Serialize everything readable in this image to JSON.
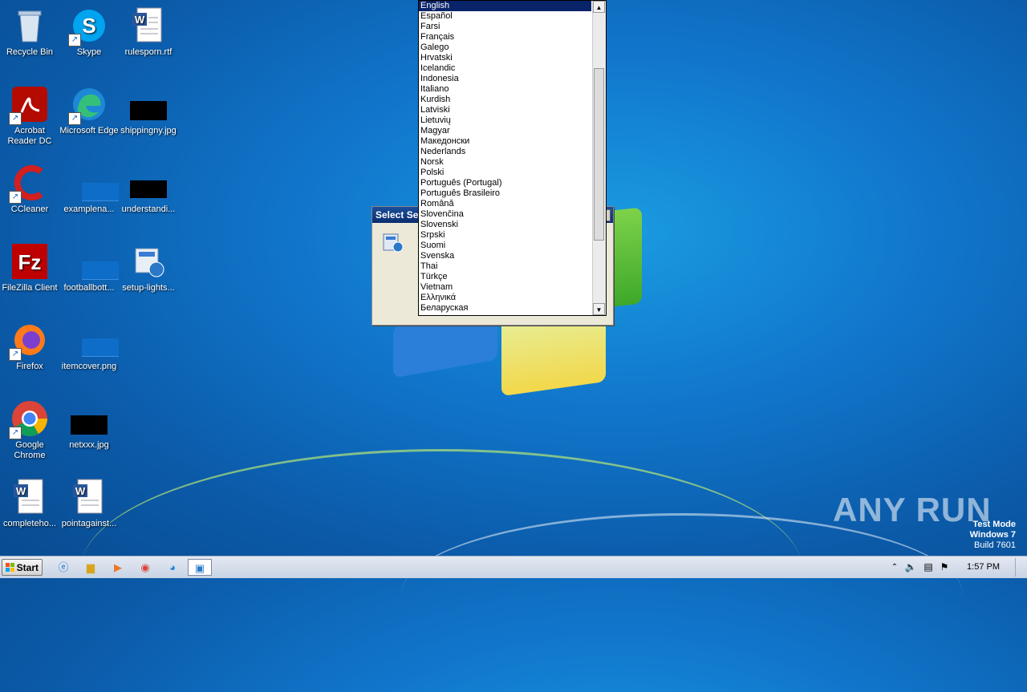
{
  "desktop_icons": [
    {
      "label": "Recycle Bin"
    },
    {
      "label": "Skype"
    },
    {
      "label": "rulesporn.rtf"
    },
    {
      "label": "Acrobat Reader DC"
    },
    {
      "label": "Microsoft Edge"
    },
    {
      "label": "shippingny.jpg"
    },
    {
      "label": "CCleaner"
    },
    {
      "label": "examplena..."
    },
    {
      "label": "understandi..."
    },
    {
      "label": "FileZilla Client"
    },
    {
      "label": "footballbott..."
    },
    {
      "label": "setup-lights..."
    },
    {
      "label": "Firefox"
    },
    {
      "label": "itemcover.png"
    },
    {
      "label": "Google Chrome"
    },
    {
      "label": "netxxx.jpg"
    },
    {
      "label": "completeho..."
    },
    {
      "label": "pointagainst..."
    }
  ],
  "dialog": {
    "title": "Select Se"
  },
  "dropdown": {
    "items": [
      "English",
      "Español",
      "Farsi",
      "Français",
      "Galego",
      "Hrvatski",
      "Icelandic",
      "Indonesia",
      "Italiano",
      "Kurdish",
      "Latviski",
      "Lietuvių",
      "Magyar",
      "Македонски",
      "Nederlands",
      "Norsk",
      "Polski",
      "Português (Portugal)",
      "Português Brasileiro",
      "Română",
      "Slovenčina",
      "Slovenski",
      "Srpski",
      "Suomi",
      "Svenska",
      "Thai",
      "Türkçe",
      "Vietnam",
      "Ελληνικά",
      "Беларуская"
    ],
    "selected": "English"
  },
  "taskbar": {
    "start_label": "Start",
    "clock": "1:57 PM"
  },
  "watermark": {
    "line1": "Test Mode",
    "line2": "Windows 7",
    "line3": "Build 7601"
  },
  "brand": {
    "text": "ANY RUN"
  }
}
